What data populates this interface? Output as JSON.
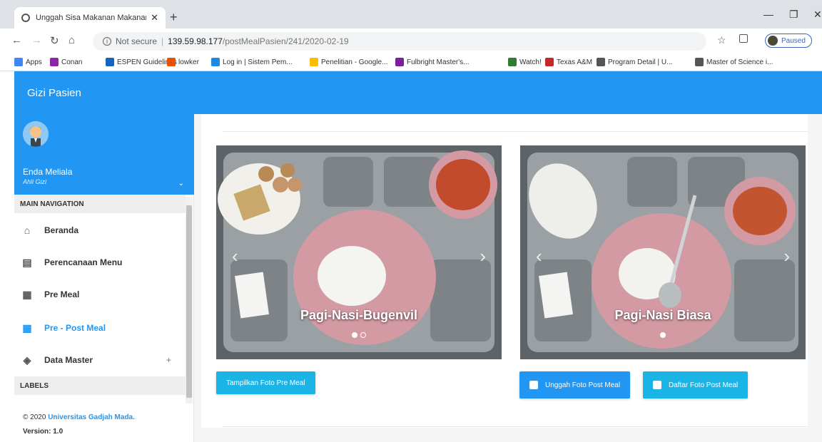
{
  "browser": {
    "tab_title": "Unggah Sisa Makanan Makanan",
    "not_secure": "Not secure",
    "url_host": "139.59.98.177",
    "url_path": "/postMealPasien/241/2020-02-19",
    "profile_status": "Paused",
    "bookmarks": [
      {
        "label": "Apps",
        "color": "#4285f4"
      },
      {
        "label": "Conan",
        "color": "#8e24aa"
      },
      {
        "label": "ESPEN Guidelines",
        "color": "#1565c0"
      },
      {
        "label": "lowker",
        "color": "#e65100"
      },
      {
        "label": "Log in | Sistem Pem...",
        "color": "#1e88e5"
      },
      {
        "label": "Penelitian - Google...",
        "color": "#fbbc04"
      },
      {
        "label": "Fulbright Master's...",
        "color": "#7b1fa2"
      },
      {
        "label": "Watch!",
        "color": "#2e7d32"
      },
      {
        "label": "Texas A&M",
        "color": "#c62828"
      },
      {
        "label": "Program Detail | U...",
        "color": "#555555"
      },
      {
        "label": "Master of Science i...",
        "color": "#555555"
      }
    ]
  },
  "app": {
    "brand": "Gizi Pasien",
    "accent": "#2196f3"
  },
  "user": {
    "name": "Enda Meliala",
    "role": "Ahli Gizi"
  },
  "sidebar": {
    "main_nav_header": "MAIN NAVIGATION",
    "items": [
      {
        "label": "Beranda",
        "icon": "home-icon"
      },
      {
        "label": "Perencanaan Menu",
        "icon": "clipboard-icon"
      },
      {
        "label": "Pre Meal",
        "icon": "photo-library-icon"
      },
      {
        "label": "Pre - Post Meal",
        "icon": "photo-library-icon",
        "active": true
      },
      {
        "label": "Data Master",
        "icon": "layers-icon",
        "expand": "+"
      }
    ],
    "labels_header": "LABELS"
  },
  "footer": {
    "copyright_prefix": "© 2020",
    "institution": "Universitas Gadjah Mada.",
    "version": "Version: 1.0"
  },
  "main": {
    "left_carousel": {
      "caption": "Pagi-Nasi-Bugenvil",
      "slides": 2,
      "active_slide": 1,
      "button": "Tampilkan Foto Pre Meal"
    },
    "right_carousel": {
      "caption": "Pagi-Nasi Biasa",
      "slides": 1,
      "active_slide": 1,
      "upload_button": "Unggah Foto Post Meal",
      "list_button": "Daftar Foto Post Meal"
    }
  }
}
